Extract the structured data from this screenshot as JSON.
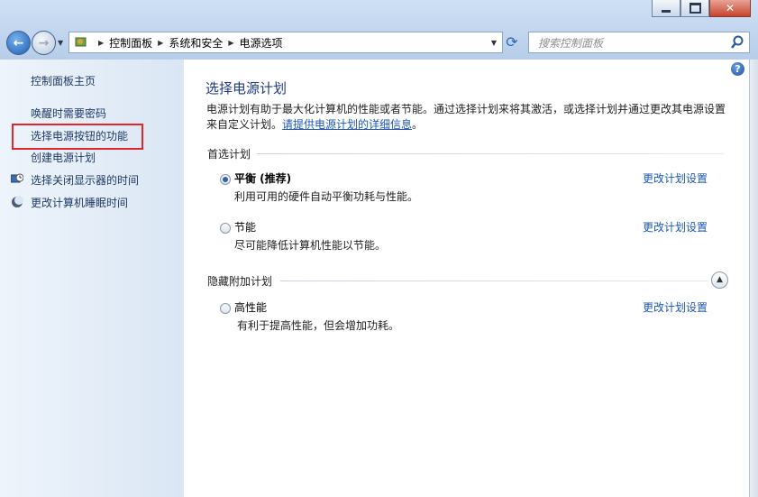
{
  "window": {
    "minimize_icon": "minimize-icon",
    "maximize_icon": "maximize-icon",
    "close_label": "✕"
  },
  "nav": {
    "back_icon": "back-arrow-icon",
    "forward_icon": "forward-arrow-icon"
  },
  "address": {
    "breadcrumbs": [
      "控制面板",
      "系统和安全",
      "电源选项"
    ],
    "refresh_icon": "refresh-icon"
  },
  "search": {
    "placeholder": "搜索控制面板"
  },
  "sidebar": {
    "items": [
      {
        "label": "控制面板主页"
      },
      {
        "label": "唤醒时需要密码"
      },
      {
        "label": "选择电源按钮的功能"
      },
      {
        "label": "创建电源计划"
      },
      {
        "label": "选择关闭显示器的时间",
        "icon": "monitor-clock-icon"
      },
      {
        "label": "更改计算机睡眠时间",
        "icon": "moon-icon"
      }
    ]
  },
  "main": {
    "title": "选择电源计划",
    "description": "电源计划有助于最大化计算机的性能或者节能。通过选择计划来将其激活，或选择计划并通过更改其电源设置来自定义计划。",
    "description_link": "请提供电源计划的详细信息",
    "description_end": "。",
    "preferred_header": "首选计划",
    "hidden_header": "隐藏附加计划",
    "change_label": "更改计划设置",
    "plans": [
      {
        "name": "平衡 (推荐)",
        "desc": "利用可用的硬件自动平衡功耗与性能。",
        "selected": true
      },
      {
        "name": "节能",
        "desc": "尽可能降低计算机性能以节能。",
        "selected": false
      },
      {
        "name": "高性能",
        "desc": "有利于提高性能，但会增加功耗。",
        "selected": false
      }
    ]
  }
}
